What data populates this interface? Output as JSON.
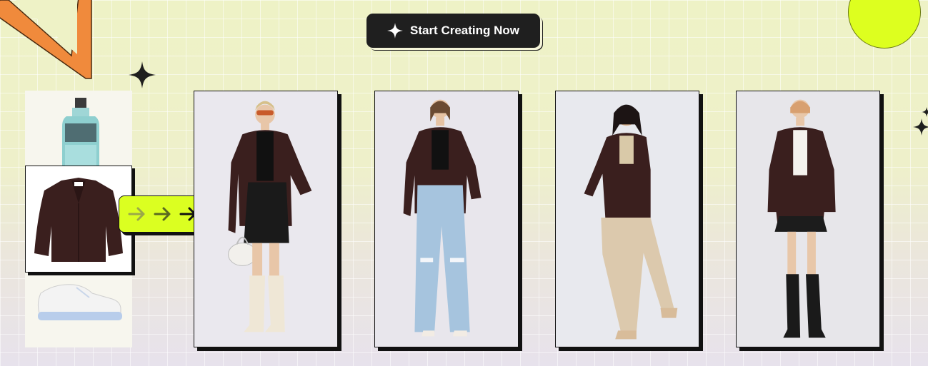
{
  "cta": {
    "label": "Start Creating Now",
    "icon": "sparkle-icon"
  },
  "colors": {
    "accent_lime": "#ddff1f",
    "accent_orange": "#f08a3c",
    "dark": "#1f1f1f",
    "blazer": "#3a1f1e"
  },
  "source_items": [
    "bottle-image",
    "blazer-image",
    "sneaker-image"
  ],
  "arrow_icon": "arrow-right-icon",
  "looks": [
    {
      "name": "look-1",
      "bottom": "black mini skirt",
      "accessories": "sunglasses, white bag, cream boots"
    },
    {
      "name": "look-2",
      "bottom": "light blue ripped jeans",
      "accessories": "white sandals"
    },
    {
      "name": "look-3",
      "bottom": "beige wide pants",
      "accessories": "beige ankle boots"
    },
    {
      "name": "look-4",
      "bottom": "pleated mini skirt",
      "accessories": "black knee boots"
    }
  ]
}
